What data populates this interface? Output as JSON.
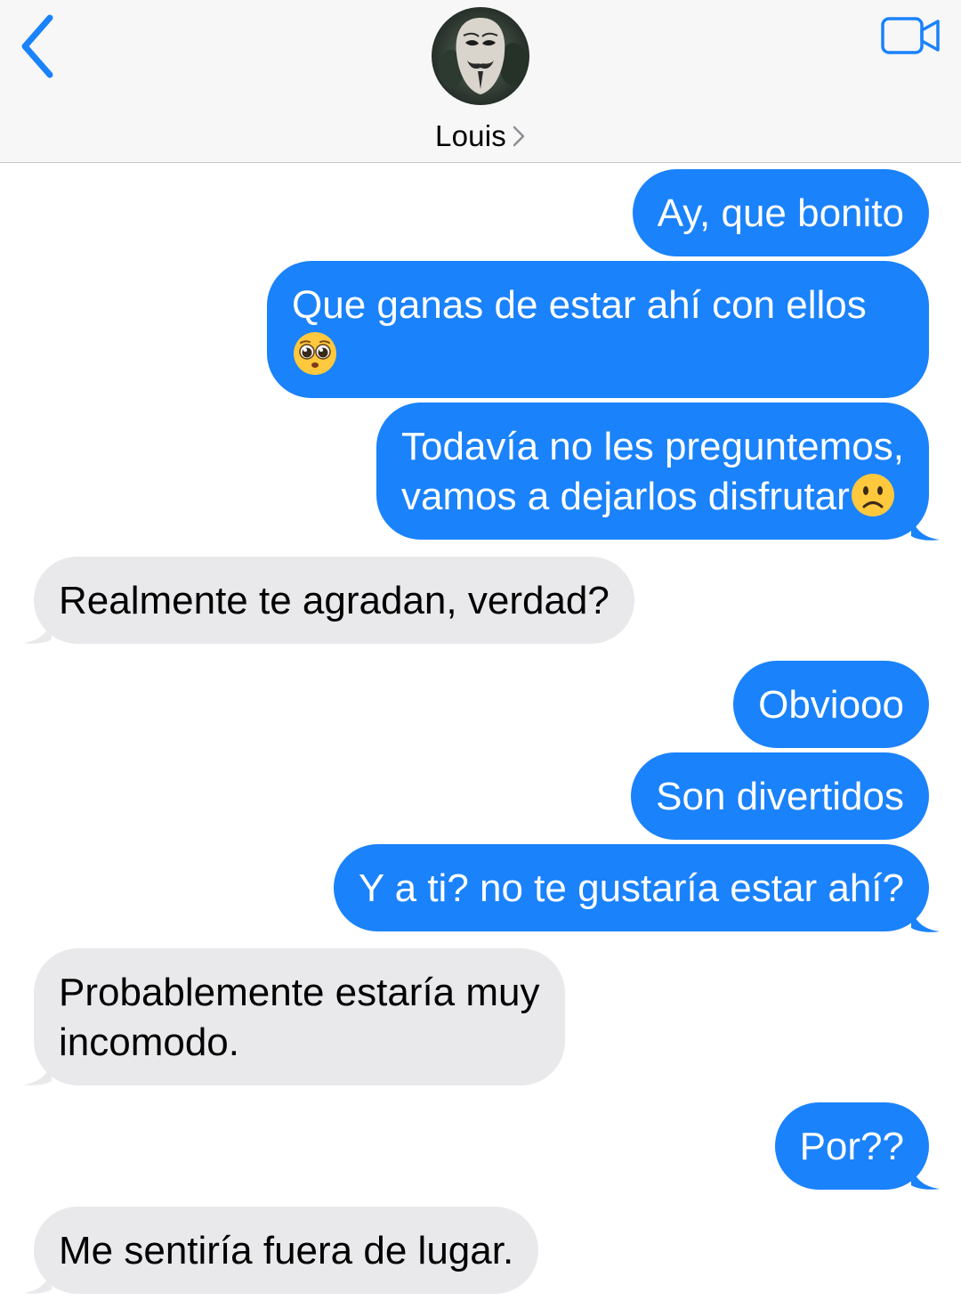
{
  "header": {
    "contact_name": "Louis",
    "back_icon": "chevron-left-icon",
    "video_icon": "video-camera-icon",
    "avatar_icon": "mask-avatar",
    "accent_color": "#1a82fb"
  },
  "colors": {
    "sent_bubble": "#1a82fb",
    "received_bubble": "#e9e9eb",
    "header_bg": "#f7f7f8"
  },
  "messages": [
    {
      "dir": "sent",
      "text": "Ay, que bonito"
    },
    {
      "dir": "sent",
      "text": "Que ganas de estar ahí con ellos",
      "emoji": "pleading-face"
    },
    {
      "dir": "sent",
      "line1": "Todavía no les preguntemos,",
      "line2": "vamos a dejarlos disfrutar",
      "emoji": "slightly-frowning-face"
    },
    {
      "dir": "received",
      "text": "Realmente te agradan, verdad?"
    },
    {
      "dir": "sent",
      "text": "Obviooo"
    },
    {
      "dir": "sent",
      "text": "Son divertidos"
    },
    {
      "dir": "sent",
      "text": "Y a ti? no te gustaría estar ahí?"
    },
    {
      "dir": "received",
      "line1": "Probablemente estaría muy",
      "line2": "incomodo."
    },
    {
      "dir": "sent",
      "text": "Por??"
    },
    {
      "dir": "received",
      "text": "Me sentiría fuera de lugar."
    }
  ]
}
